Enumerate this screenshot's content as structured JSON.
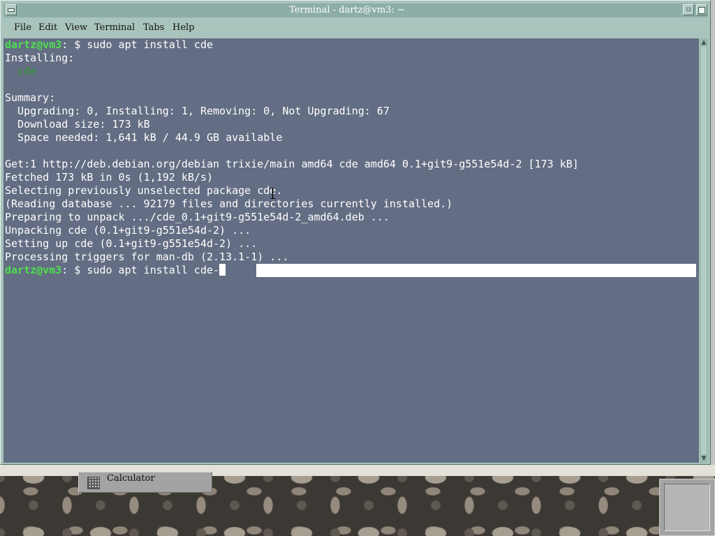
{
  "window": {
    "title": "Terminal - dartz@vm3: ~"
  },
  "menubar": {
    "items": [
      "File",
      "Edit",
      "View",
      "Terminal",
      "Tabs",
      "Help"
    ]
  },
  "terminal": {
    "prompt_user": "dartz@vm3",
    "prompt_path": ":",
    "prompt_symbol": " $ ",
    "command_1": "sudo apt install cde",
    "output": [
      "Installing:",
      "  cde",
      "",
      "Summary:",
      "  Upgrading: 0, Installing: 1, Removing: 0, Not Upgrading: 67",
      "  Download size: 173 kB",
      "  Space needed: 1,641 kB / 44.9 GB available",
      "",
      "Get:1 http://deb.debian.org/debian trixie/main amd64 cde amd64 0.1+git9-g551e54d-2 [173 kB]",
      "Fetched 173 kB in 0s (1,192 kB/s)",
      "Selecting previously unselected package cde.",
      "(Reading database ... 92179 files and directories currently installed.)",
      "Preparing to unpack .../cde_0.1+git9-g551e54d-2_amd64.deb ...",
      "Unpacking cde (0.1+git9-g551e54d-2) ...",
      "Setting up cde (0.1+git9-g551e54d-2) ...",
      "Processing triggers for man-db (2.13.1-1) ..."
    ],
    "command_2": "sudo apt install cde-"
  },
  "desktop": {
    "panel_label": "Calculator"
  },
  "colors": {
    "terminal_bg": "#636d83",
    "prompt_green": "#4ee04e",
    "window_frame": "#a9c4bd"
  }
}
